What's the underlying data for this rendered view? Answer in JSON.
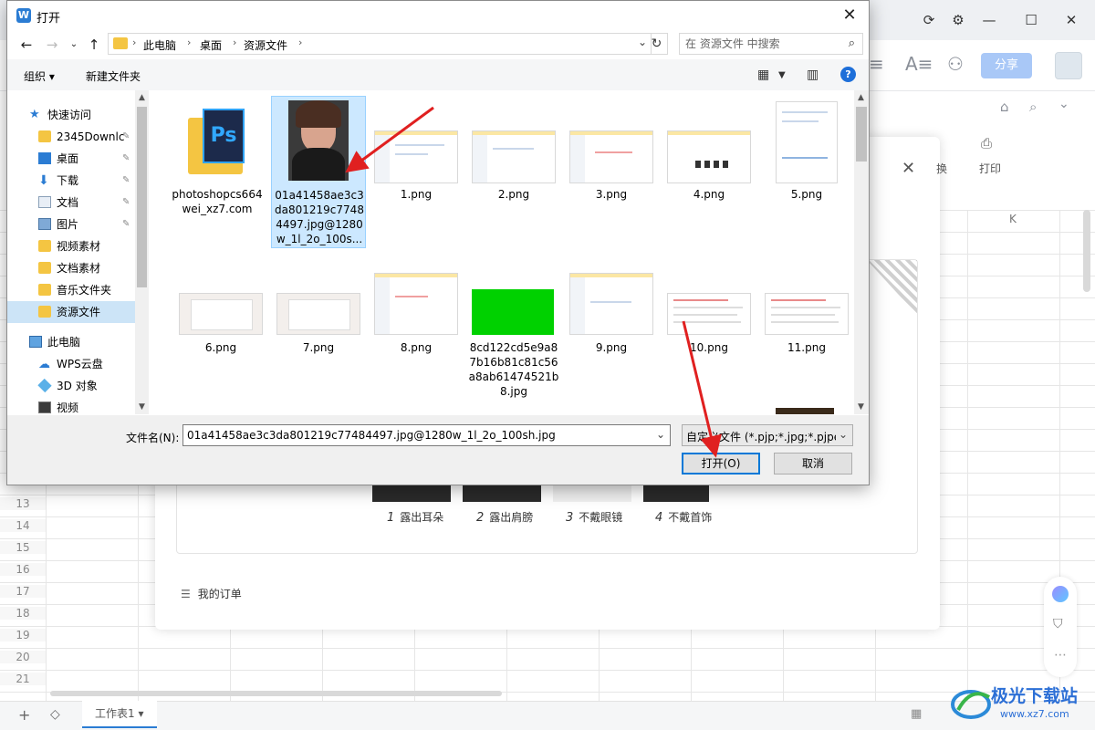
{
  "background_app": {
    "share_label": "分享",
    "replace_label": "换",
    "print_label": "打印",
    "column_label": "K",
    "row_numbers": [
      "13",
      "14",
      "15",
      "16",
      "17",
      "18",
      "19",
      "20",
      "21"
    ],
    "sheet_tab": "工作表1",
    "requirements": [
      {
        "num": "1",
        "label": "露出耳朵"
      },
      {
        "num": "2",
        "label": "露出肩膀"
      },
      {
        "num": "3",
        "label": "不戴眼镜"
      },
      {
        "num": "4",
        "label": "不戴首饰"
      }
    ],
    "orders_label": "我的订单",
    "watermark_text": "极光下载站",
    "watermark_url": "www.xz7.com"
  },
  "dialog": {
    "title": "打开",
    "breadcrumbs": [
      "此电脑",
      "桌面",
      "资源文件"
    ],
    "search_placeholder": "在 资源文件 中搜索",
    "organize_label": "组织 ▾",
    "new_folder_label": "新建文件夹",
    "help_glyph": "?",
    "nav_items": [
      {
        "label": "快速访问",
        "icon": "star-icon",
        "top": true
      },
      {
        "label": "2345Downlc",
        "icon": "folder-icon",
        "pinned": true
      },
      {
        "label": "桌面",
        "icon": "desktop-icon",
        "pinned": true
      },
      {
        "label": "下载",
        "icon": "download-icon",
        "pinned": true
      },
      {
        "label": "文档",
        "icon": "document-icon",
        "pinned": true
      },
      {
        "label": "图片",
        "icon": "picture-icon",
        "pinned": true
      },
      {
        "label": "视频素材",
        "icon": "folder-icon"
      },
      {
        "label": "文档素材",
        "icon": "folder-icon"
      },
      {
        "label": "音乐文件夹",
        "icon": "folder-icon"
      },
      {
        "label": "资源文件",
        "icon": "folder-icon",
        "selected": true
      },
      {
        "label": "此电脑",
        "icon": "computer-icon",
        "top": true
      },
      {
        "label": "WPS云盘",
        "icon": "cloud-icon"
      },
      {
        "label": "3D 对象",
        "icon": "3d-object-icon"
      },
      {
        "label": "视频",
        "icon": "video-icon"
      }
    ],
    "files": [
      {
        "name": "photoshopcs664wei_xz7.com",
        "kind": "folder-ps"
      },
      {
        "name": "01a41458ae3c3da801219c77484497.jpg@1280w_1l_2o_100s...",
        "kind": "portrait",
        "selected": true
      },
      {
        "name": "1.png",
        "kind": "screenshot"
      },
      {
        "name": "2.png",
        "kind": "screenshot"
      },
      {
        "name": "3.png",
        "kind": "screenshot"
      },
      {
        "name": "4.png",
        "kind": "screenshot"
      },
      {
        "name": "5.png",
        "kind": "screenshot-tall"
      },
      {
        "name": "6.png",
        "kind": "screenshot-gray"
      },
      {
        "name": "7.png",
        "kind": "screenshot-gray"
      },
      {
        "name": "8.png",
        "kind": "screenshot"
      },
      {
        "name": "8cd122cd5e9a87b16b81c81c56a8ab61474521b8.jpg",
        "kind": "green"
      },
      {
        "name": "9.png",
        "kind": "screenshot"
      },
      {
        "name": "10.png",
        "kind": "doc"
      },
      {
        "name": "11.png",
        "kind": "doc"
      }
    ],
    "filename_label": "文件名(N):",
    "filename_value": "01a41458ae3c3da801219c77484497.jpg@1280w_1l_2o_100sh.jpg",
    "filetype_value": "自定义文件 (*.pjp;*.jpg;*.pjpeg",
    "open_label": "打开(O)",
    "cancel_label": "取消"
  },
  "colors": {
    "selection": "#cce8ff",
    "accent": "#0078d7",
    "annotation_arrow": "#e02020",
    "green_file": "#00d100"
  }
}
